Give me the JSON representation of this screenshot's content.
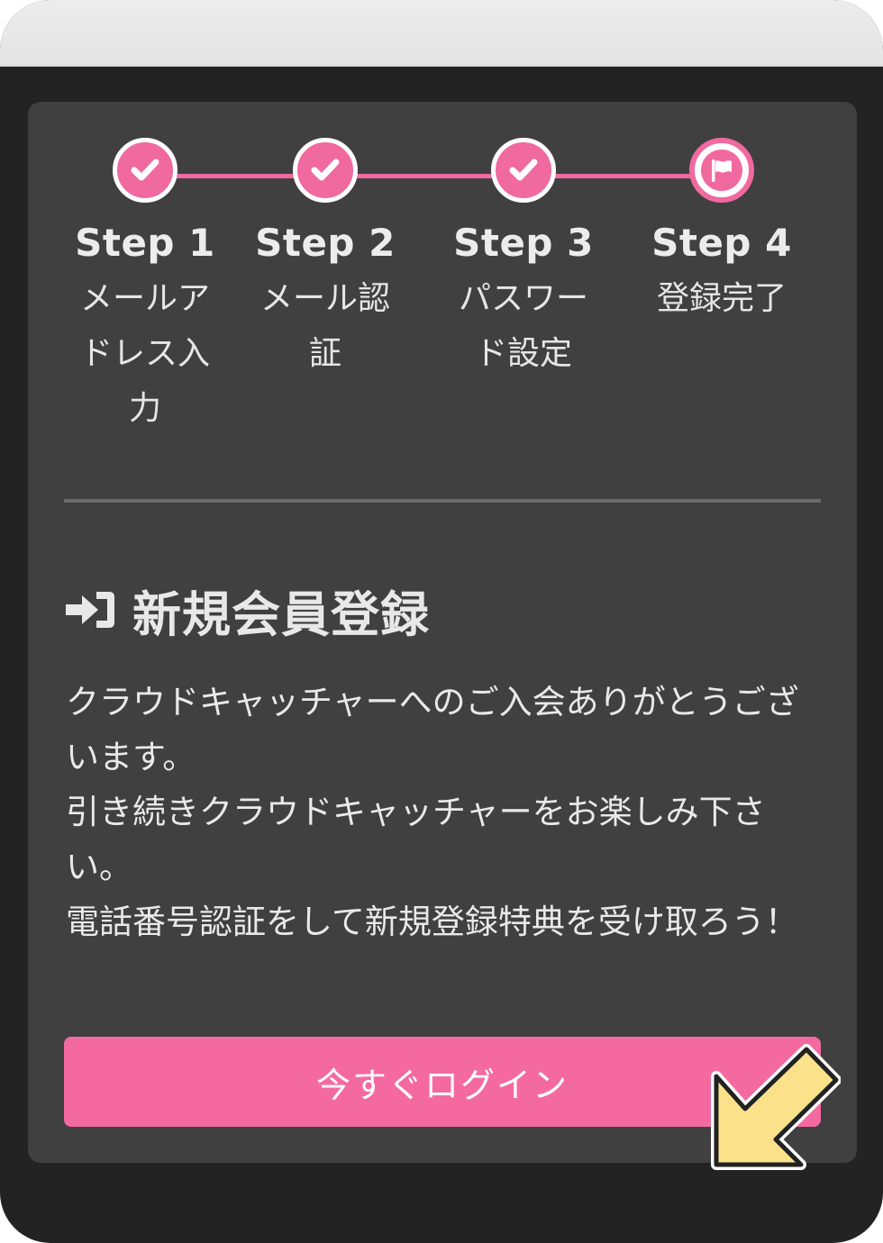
{
  "steps": [
    {
      "title": "Step 1",
      "desc": "メールアドレス入力",
      "state": "done",
      "icon": "check-icon"
    },
    {
      "title": "Step 2",
      "desc": "メール認証",
      "state": "done",
      "icon": "check-icon"
    },
    {
      "title": "Step 3",
      "desc": "パスワード設定",
      "state": "done",
      "icon": "check-icon"
    },
    {
      "title": "Step 4",
      "desc": "登録完了",
      "state": "current",
      "icon": "flag-icon"
    }
  ],
  "section": {
    "icon": "sign-in-icon",
    "title": "新規会員登録"
  },
  "message": {
    "line1": "クラウドキャッチャーへのご入会ありがとうございます。",
    "line2": "引き続きクラウドキャッチャーをお楽しみ下さい。",
    "line3": "電話番号認証をして新規登録特典を受け取ろう！"
  },
  "login_button": {
    "label": "今すぐログイン"
  },
  "colors": {
    "accent": "#f46aa0",
    "card": "#404040",
    "background": "#232323",
    "pointer_arrow": "#fbe28a"
  }
}
